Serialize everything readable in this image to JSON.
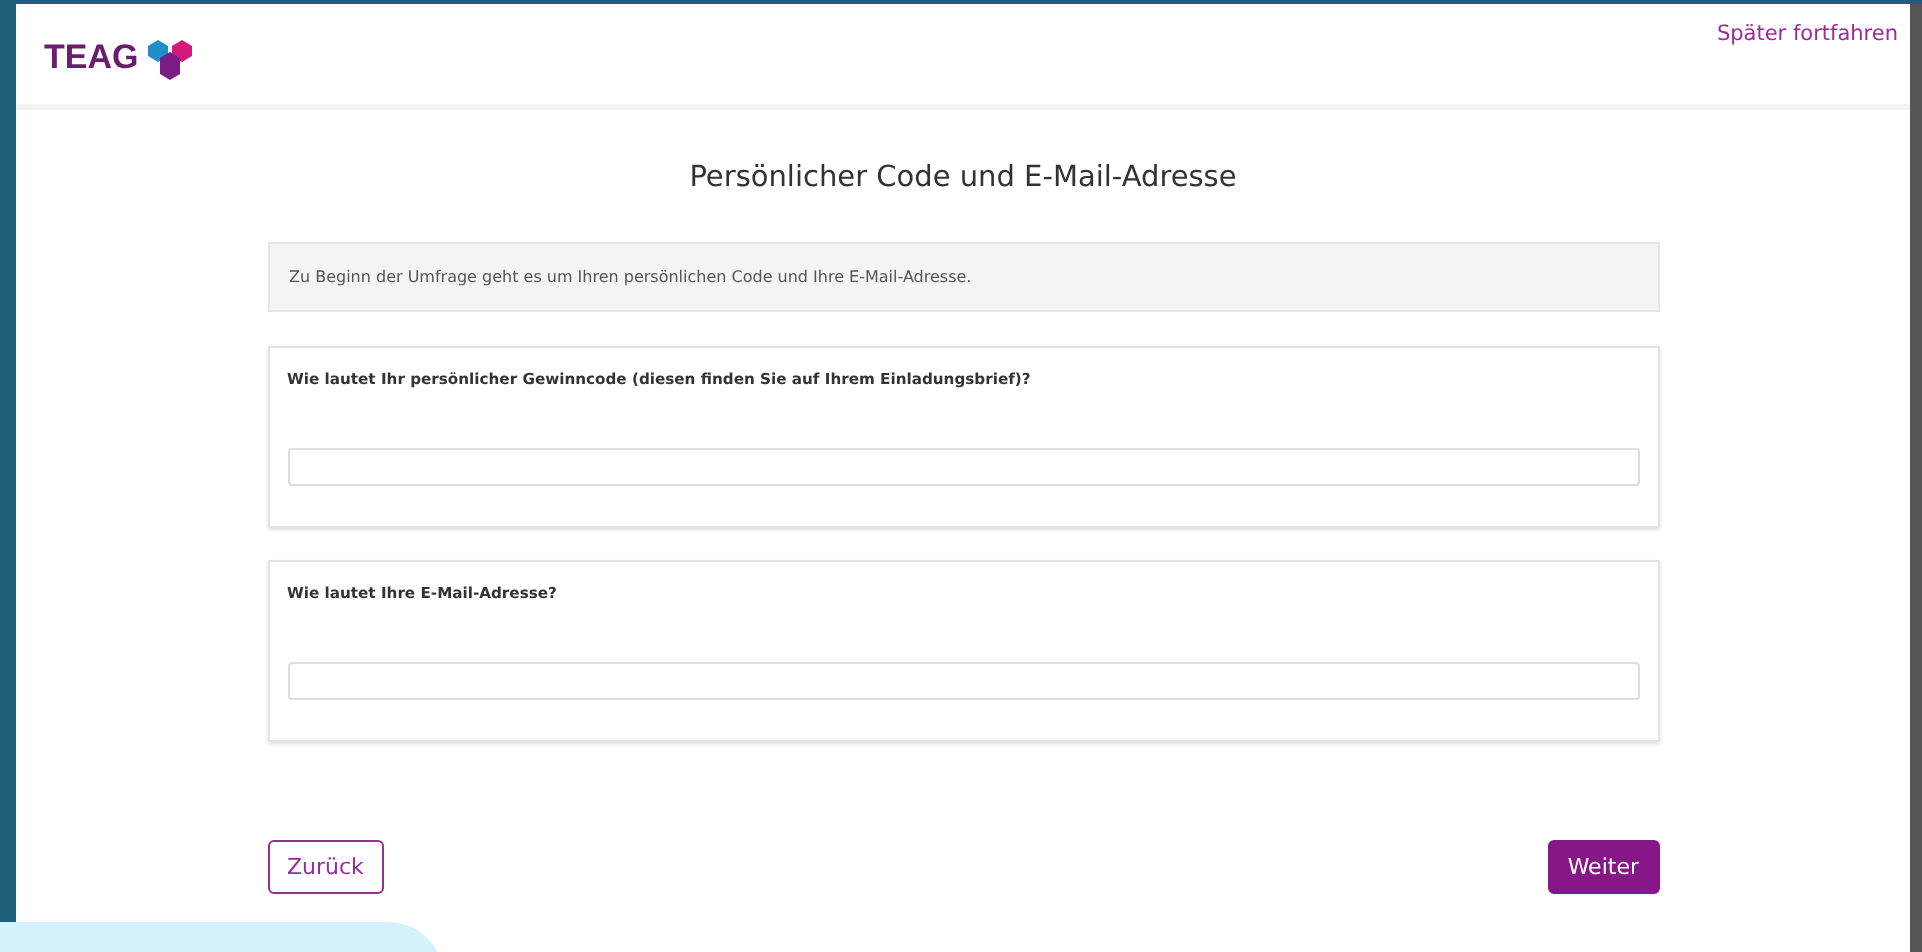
{
  "header": {
    "logo_text": "TEAG",
    "link": "Später fortfahren"
  },
  "title": "Persönlicher Code und E-Mail-Adresse",
  "intro": "Zu Beginn der Umfrage geht es um Ihren persönlichen Code und Ihre E-Mail-Adresse.",
  "questions": [
    {
      "label": "Wie lautet Ihr persönlicher Gewinncode (diesen finden Sie auf Ihrem Einladungsbrief)?"
    },
    {
      "label": "Wie lautet Ihre E-Mail-Adresse?"
    }
  ],
  "buttons": {
    "back": "Zurück",
    "next": "Weiter"
  }
}
